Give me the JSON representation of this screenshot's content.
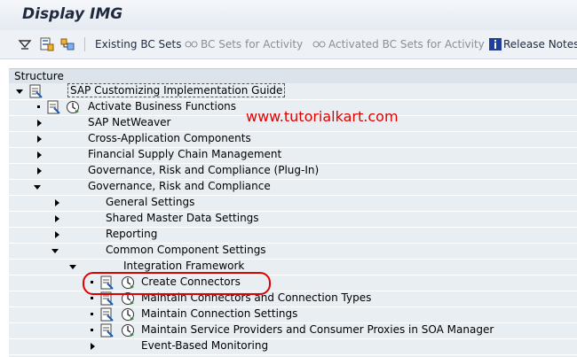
{
  "window": {
    "title": "Display IMG"
  },
  "toolbar": {
    "icons": [
      "expand-tree-icon",
      "where-used-icon",
      "find-icon"
    ],
    "existing_bc_sets": "Existing BC Sets",
    "bc_sets_for_activity": "BC Sets for Activity",
    "activated_bc_sets_for_activity": "Activated BC Sets for Activity",
    "release_notes": "Release Notes"
  },
  "structure": {
    "header": "Structure",
    "root": {
      "label": "SAP Customizing Implementation Guide",
      "expanded": true
    },
    "items": [
      {
        "label": "Activate Business Functions",
        "level": 1,
        "type": "activity"
      },
      {
        "label": "SAP NetWeaver",
        "level": 1,
        "type": "node",
        "expanded": false
      },
      {
        "label": "Cross-Application Components",
        "level": 1,
        "type": "node",
        "expanded": false
      },
      {
        "label": "Financial Supply Chain Management",
        "level": 1,
        "type": "node",
        "expanded": false
      },
      {
        "label": "Governance, Risk and Compliance (Plug-In)",
        "level": 1,
        "type": "node",
        "expanded": false
      },
      {
        "label": "Governance, Risk and Compliance",
        "level": 1,
        "type": "node",
        "expanded": true
      },
      {
        "label": "General Settings",
        "level": 2,
        "type": "node",
        "expanded": false
      },
      {
        "label": "Shared Master Data Settings",
        "level": 2,
        "type": "node",
        "expanded": false
      },
      {
        "label": "Reporting",
        "level": 2,
        "type": "node",
        "expanded": false
      },
      {
        "label": "Common Component Settings",
        "level": 2,
        "type": "node",
        "expanded": true
      },
      {
        "label": "Integration Framework",
        "level": 3,
        "type": "node",
        "expanded": true
      },
      {
        "label": "Create Connectors",
        "level": 4,
        "type": "activity",
        "highlighted": true
      },
      {
        "label": "Maintain Connectors and Connection Types",
        "level": 4,
        "type": "activity"
      },
      {
        "label": "Maintain Connection Settings",
        "level": 4,
        "type": "activity"
      },
      {
        "label": "Maintain Service Providers and Consumer Proxies in SOA Manager",
        "level": 4,
        "type": "activity"
      },
      {
        "label": "Event-Based Monitoring",
        "level": 4,
        "type": "node",
        "expanded": false
      }
    ]
  },
  "watermark": "www.tutorialkart.com",
  "colors": {
    "annotation": "#e00000",
    "tree_background": "#e9eef3",
    "header_background": "#dce3ea"
  }
}
